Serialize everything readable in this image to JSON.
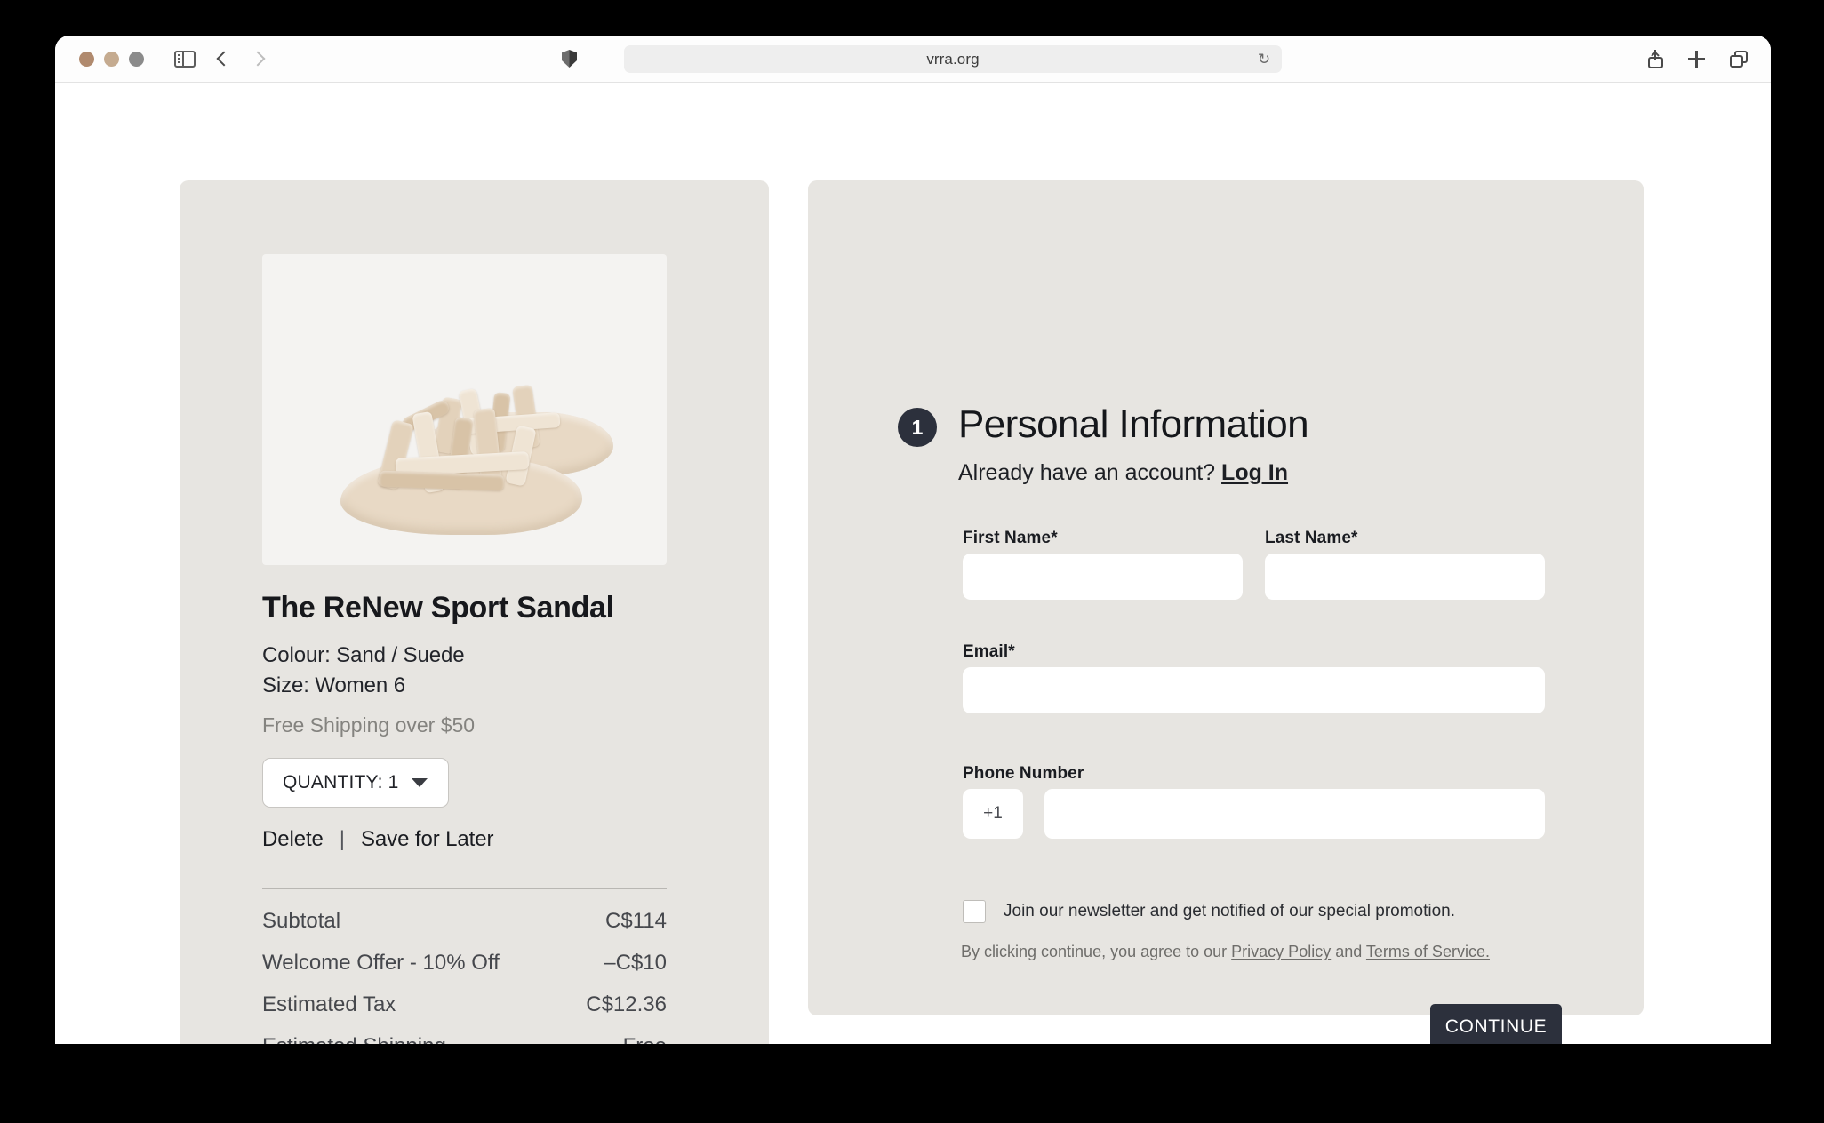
{
  "browser": {
    "url": "vrra.org",
    "reload_glyph": "↻",
    "traffic_lights": [
      "close",
      "minimize",
      "zoom"
    ],
    "icons": {
      "sidebar": "sidebar-toggle-icon",
      "back": "back-icon",
      "forward": "forward-icon",
      "shield": "privacy-shield-icon",
      "share": "share-icon",
      "new_tab": "plus-icon",
      "tab_overview": "tab-overview-icon"
    }
  },
  "cart": {
    "product": {
      "title": "The ReNew Sport Sandal",
      "colour": "Colour: Sand / Suede",
      "size": "Size: Women 6",
      "shipping_note": "Free Shipping over $50",
      "image_alt": "sand suede sport sandal pair"
    },
    "quantity": {
      "label": "QUANTITY: 1",
      "value": 1
    },
    "actions": {
      "delete": "Delete",
      "separator": "|",
      "save_for_later": "Save for Later"
    },
    "summary": [
      {
        "label": "Subtotal",
        "value": "C$114"
      },
      {
        "label": "Welcome Offer - 10% Off",
        "value": "–C$10"
      },
      {
        "label": "Estimated Tax",
        "value": "C$12.36"
      },
      {
        "label": "Estimated Shipping",
        "value": "Free"
      }
    ]
  },
  "checkout": {
    "step_number": "1",
    "heading": "Personal Information",
    "account_prompt": "Already have an account? ",
    "login_label": "Log In",
    "fields": {
      "first_name": {
        "label": "First Name*",
        "value": "",
        "placeholder": ""
      },
      "last_name": {
        "label": "Last Name*",
        "value": "",
        "placeholder": ""
      },
      "email": {
        "label": "Email*",
        "value": "",
        "placeholder": ""
      },
      "phone": {
        "label": "Phone Number",
        "value": "",
        "placeholder": "",
        "country_code": "+1"
      }
    },
    "newsletter": {
      "label": "Join our newsletter and get notified of our special promotion.",
      "checked": false
    },
    "legal": {
      "prefix": "By clicking continue, you agree to our ",
      "privacy_policy": "Privacy Policy",
      "conjunction": " and ",
      "terms": "Terms of Service."
    },
    "continue_label": "CONTINUE"
  },
  "colors": {
    "panel": "#e7e5e1",
    "accent_dark": "#2c303c",
    "product_bg": "#f4f3f1",
    "sandal": "#e3d2bb"
  }
}
